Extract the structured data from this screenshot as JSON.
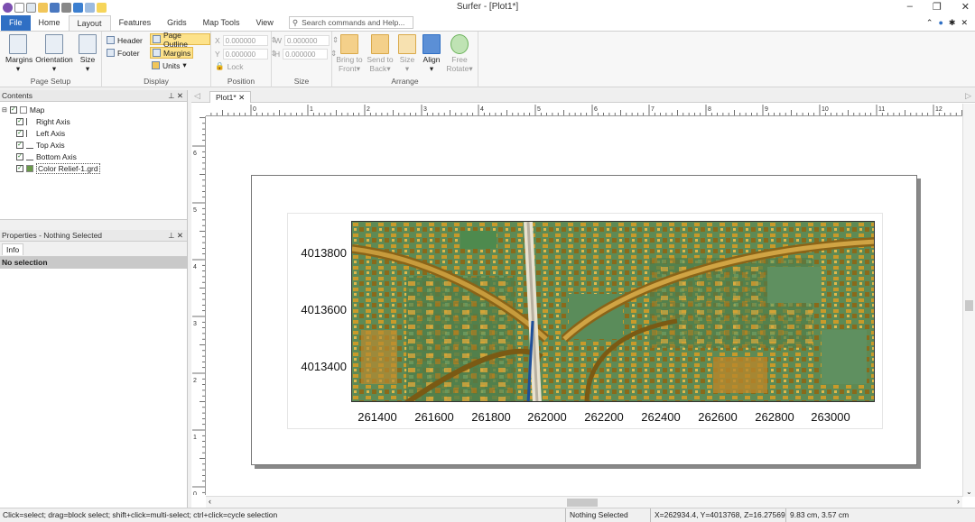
{
  "window": {
    "title": "Surfer - [Plot1*]",
    "min": "–",
    "restore": "❐",
    "close": "✕"
  },
  "tabs": [
    "File",
    "Home",
    "Layout",
    "Features",
    "Grids",
    "Map Tools",
    "View"
  ],
  "search": {
    "placeholder": "Search commands and Help..."
  },
  "ribbon": {
    "page_setup": {
      "label": "Page Setup",
      "margins": "Margins",
      "orientation": "Orientation",
      "size": "Size"
    },
    "display": {
      "label": "Display",
      "header": "Header",
      "footer": "Footer",
      "page_outline": "Page Outline",
      "margins": "Margins",
      "units": "Units"
    },
    "position": {
      "label": "Position",
      "x": "X",
      "y": "Y",
      "x_val": "0.000000",
      "y_val": "0.000000",
      "lock": "Lock"
    },
    "size": {
      "label": "Size",
      "w": "W",
      "h": "H",
      "w_val": "0.000000",
      "h_val": "0.000000"
    },
    "arrange": {
      "label": "Arrange",
      "bring": "Bring to",
      "bring2": "Front",
      "send": "Send to",
      "send2": "Back",
      "size": "Size",
      "align": "Align",
      "free": "Free",
      "rotate": "Rotate"
    }
  },
  "contents": {
    "title": "Contents",
    "items": [
      {
        "label": "Map",
        "indent": 0
      },
      {
        "label": "Right Axis",
        "indent": 1
      },
      {
        "label": "Left Axis",
        "indent": 1
      },
      {
        "label": "Top Axis",
        "indent": 1
      },
      {
        "label": "Bottom Axis",
        "indent": 1
      },
      {
        "label": "Color Relief-1.grd",
        "indent": 1
      }
    ]
  },
  "properties": {
    "title": "Properties - Nothing Selected",
    "tab": "Info",
    "nosel": "No selection"
  },
  "document": {
    "tab": "Plot1*"
  },
  "ruler": {
    "h": [
      "0",
      "1",
      "2",
      "3",
      "4",
      "5",
      "6",
      "7",
      "8",
      "9",
      "10",
      "11",
      "12"
    ],
    "v": [
      "6",
      "5",
      "4",
      "3",
      "2",
      "1",
      "0"
    ]
  },
  "map": {
    "y_ticks": [
      "4013800",
      "4013600",
      "4013400"
    ],
    "x_ticks": [
      "261400",
      "261600",
      "261800",
      "262000",
      "262200",
      "262400",
      "262600",
      "262800",
      "263000"
    ]
  },
  "status": {
    "hint": "Click=select; drag=block select; shift+click=multi-select; ctrl+click=cycle selection",
    "selection": "Nothing Selected",
    "coords": "X=262934.4, Y=4013768, Z=16.27569",
    "size": "9.83 cm, 3.57 cm"
  }
}
